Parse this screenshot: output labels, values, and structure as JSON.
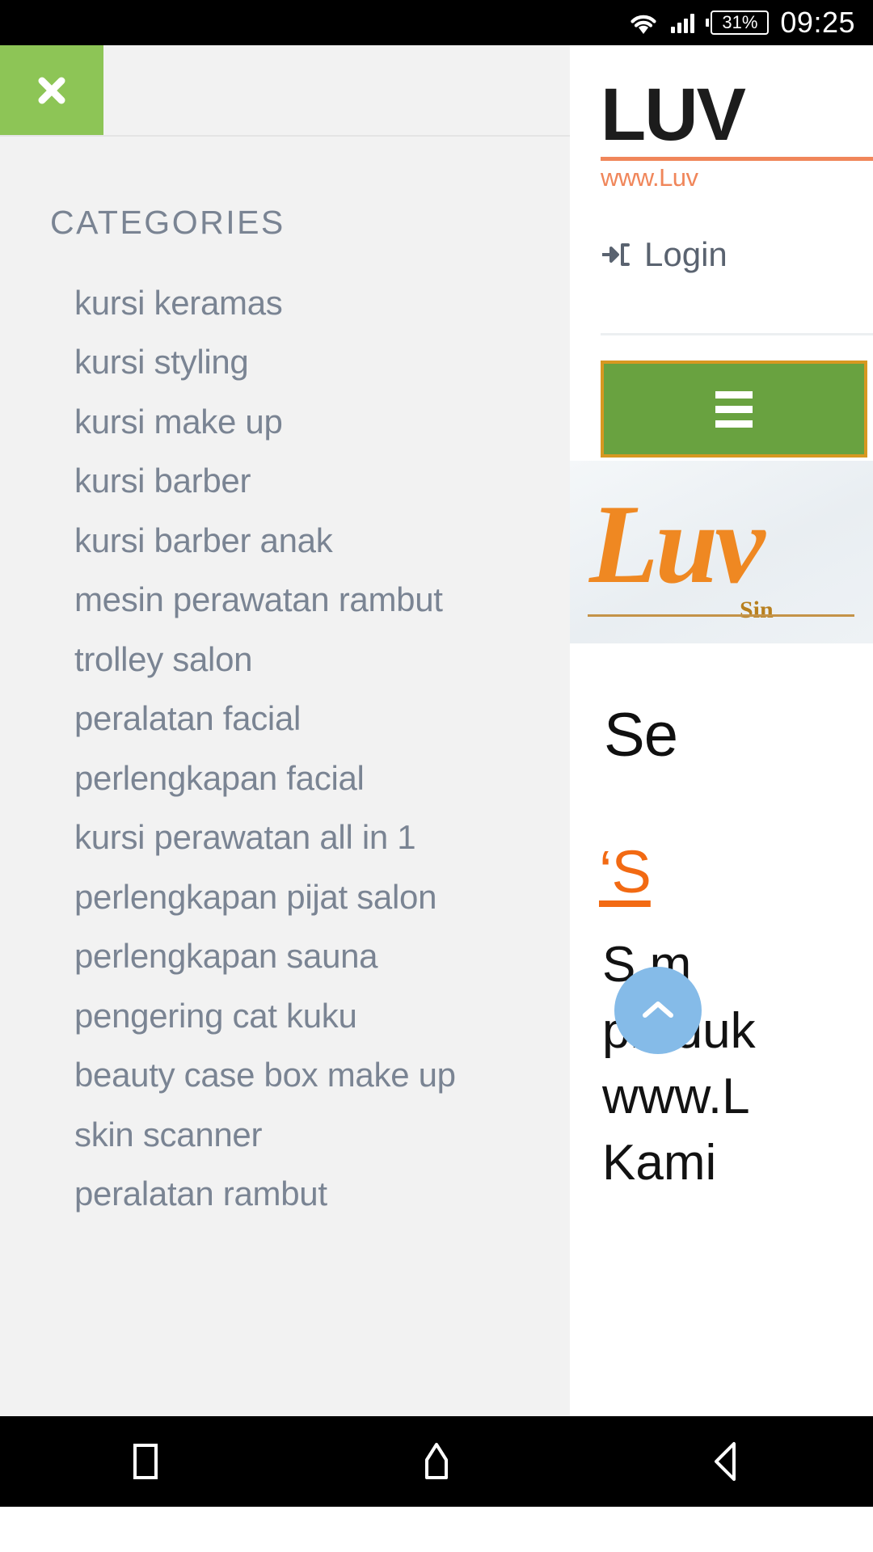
{
  "status_bar": {
    "battery_percent": "31%",
    "time": "09:25",
    "wifi_icon": "wifi-icon",
    "signal_icon": "cell-signal-icon",
    "battery_icon": "battery-icon"
  },
  "offcanvas": {
    "close_icon": "close-icon",
    "title": "CATEGORIES",
    "items": [
      {
        "label": "kursi keramas"
      },
      {
        "label": "kursi styling"
      },
      {
        "label": "kursi make up"
      },
      {
        "label": "kursi barber"
      },
      {
        "label": "kursi barber anak"
      },
      {
        "label": "mesin perawatan rambut"
      },
      {
        "label": "trolley salon"
      },
      {
        "label": "peralatan facial"
      },
      {
        "label": "perlengkapan facial"
      },
      {
        "label": "kursi perawatan all in 1"
      },
      {
        "label": "perlengkapan pijat salon"
      },
      {
        "label": "perlengkapan sauna"
      },
      {
        "label": "pengering cat kuku"
      },
      {
        "label": "beauty case box make up"
      },
      {
        "label": "skin scanner"
      },
      {
        "label": "peralatan rambut"
      }
    ]
  },
  "site": {
    "logo_text": "LUV",
    "logo_url": "www.Luv",
    "login_label": "Login",
    "login_icon": "sign-in-icon",
    "menu_icon": "hamburger-icon",
    "banner_script": "Luv",
    "banner_sub": "Sin",
    "heading": "Se",
    "subheading": "‘S",
    "paragraph_lines": [
      "S        m",
      "produk",
      "www.L",
      "Kami"
    ],
    "scroll_top_icon": "chevron-up-icon"
  },
  "navbar": {
    "recents_icon": "recents-square-icon",
    "home_icon": "home-icon",
    "back_icon": "back-triangle-icon"
  },
  "colors": {
    "accent_green": "#8dc556",
    "button_green": "#69a240",
    "button_border": "#d79821",
    "brand_orange": "#ef8822",
    "heading_orange": "#f26a13",
    "menu_text": "#7a8493",
    "panel_bg": "#f2f2f2",
    "fab_blue": "#85bbe8"
  }
}
